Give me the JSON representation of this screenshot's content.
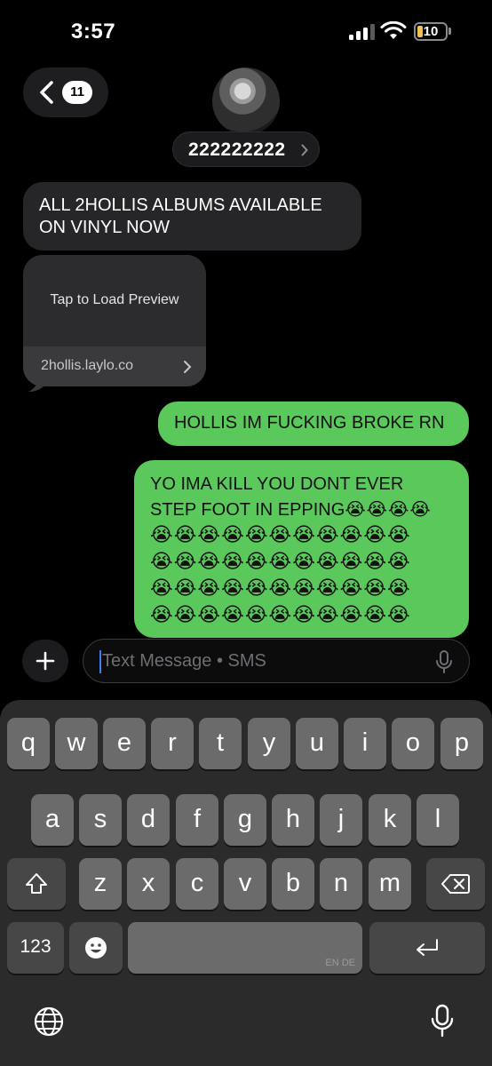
{
  "status_bar": {
    "time": "3:57",
    "battery": "10",
    "signal_bars": 3
  },
  "header": {
    "back_count": "11",
    "contact_name": "222222222"
  },
  "messages": {
    "incoming_1": {
      "line1": "ALL 2HOLLIS ALBUMS AVAILABLE",
      "line2": "ON VINYL NOW"
    },
    "link_preview": {
      "label": "Tap to Load Preview",
      "url": "2hollis.laylo.co"
    },
    "outgoing_1": "HOLLIS IM FUCKING BROKE RN",
    "outgoing_2": {
      "line1": "YO IMA KILL YOU DONT EVER",
      "line2": "STEP FOOT IN EPPING",
      "line2_emoji": "😭😭😭😭",
      "emoji_rows": [
        "😭😭😭😭😭😭😭😭😭😭😭",
        "😭😭😭😭😭😭😭😭😭😭😭",
        "😭😭😭😭😭😭😭😭😭😭😭",
        "😭😭😭😭😭😭😭😭😭😭😭"
      ]
    }
  },
  "composer": {
    "placeholder": "Text Message • SMS"
  },
  "keyboard": {
    "row1": [
      "q",
      "w",
      "e",
      "r",
      "t",
      "y",
      "u",
      "i",
      "o",
      "p"
    ],
    "row2": [
      "a",
      "s",
      "d",
      "f",
      "g",
      "h",
      "j",
      "k",
      "l"
    ],
    "row3": [
      "z",
      "x",
      "c",
      "v",
      "b",
      "n",
      "m"
    ],
    "numbers_label": "123",
    "space_languages": "EN DE"
  },
  "icons": {
    "back": "chevron-left-icon",
    "add": "plus-icon",
    "dictation": "microphone-icon",
    "shift": "shift-icon",
    "delete": "delete-icon",
    "emoji": "emoji-icon",
    "return": "return-icon",
    "globe": "globe-icon"
  },
  "colors": {
    "outgoing_bubble": "#5ac85a",
    "incoming_bubble": "#262628",
    "cursor": "#3d7ff5"
  }
}
